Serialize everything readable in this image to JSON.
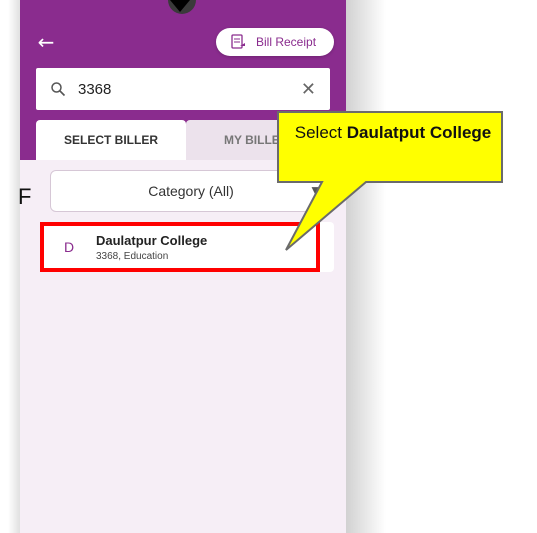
{
  "header": {
    "back_icon": "arrow-left-icon",
    "receipt_label": "Bill Receipt",
    "receipt_icon": "receipt-icon"
  },
  "search": {
    "value": "3368",
    "search_icon": "search-icon",
    "clear_icon": "close-icon"
  },
  "tabs": [
    {
      "label": "SELECT BILLER",
      "active": true
    },
    {
      "label": "MY BILLE",
      "active": false
    }
  ],
  "filter": {
    "letter": "F",
    "category_label": "Category (All)",
    "chevron_icon": "chevron-down-icon"
  },
  "biller": {
    "avatar_letter": "D",
    "name": "Daulatpur College",
    "subtitle": "3368, Education"
  },
  "callout": {
    "prefix": "Select ",
    "bold": "Daulatput College"
  },
  "colors": {
    "brand": "#8a2c8e",
    "background": "#f6eef6",
    "highlight": "#ff0000",
    "callout_fill": "#ffff00"
  }
}
